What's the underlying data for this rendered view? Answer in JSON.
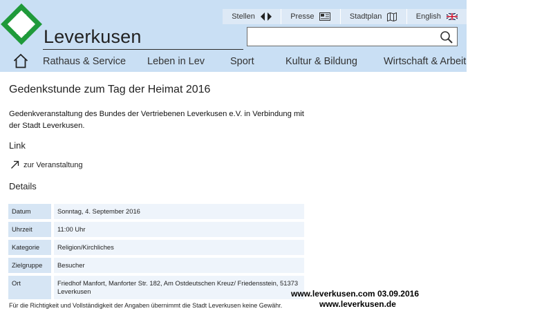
{
  "header": {
    "brand": "Leverkusen",
    "topbar": [
      {
        "label": "Stellen",
        "icon": "arrows-icon"
      },
      {
        "label": "Presse",
        "icon": "newspaper-icon"
      },
      {
        "label": "Stadtplan",
        "icon": "map-icon"
      },
      {
        "label": "English",
        "icon": "uk-flag-icon"
      }
    ],
    "search": {
      "placeholder": "",
      "value": ""
    },
    "nav": [
      "Rathaus & Service",
      "Leben in Lev",
      "Sport",
      "Kultur & Bildung",
      "Wirtschaft & Arbeit"
    ]
  },
  "page": {
    "title": "Gedenkstunde zum Tag der Heimat 2016",
    "description": "Gedenkveranstaltung des Bundes der Vertriebenen Leverkusen e.V. in Verbindung mit der Stadt Leverkusen.",
    "link_heading": "Link",
    "link_label": "zur Veranstaltung",
    "details_heading": "Details",
    "details": [
      {
        "key": "Datum",
        "value": "Sonntag, 4. September 2016"
      },
      {
        "key": "Uhrzeit",
        "value": "11:00 Uhr"
      },
      {
        "key": "Kategorie",
        "value": "Religion/Kirchliches"
      },
      {
        "key": "Zielgruppe",
        "value": "Besucher"
      },
      {
        "key": "Ort",
        "value": "Friedhof Manfort, Manforter Str. 182, Am Ostdeutschen Kreuz/ Friedensstein, 51373 Leverkusen"
      }
    ],
    "disclaimer": "Für die Richtigkeit und Vollständigkeit der Angaben übernimmt die Stadt Leverkusen keine Gewähr."
  },
  "watermark": {
    "line1": "www.leverkusen.com  03.09.2016",
    "line2": "www.leverkusen.de"
  },
  "colors": {
    "header_bg": "#c9dff4",
    "logo_green": "#1f9a3a",
    "detail_key_bg": "#d6e5f4",
    "detail_value_bg": "#eef4fb"
  }
}
